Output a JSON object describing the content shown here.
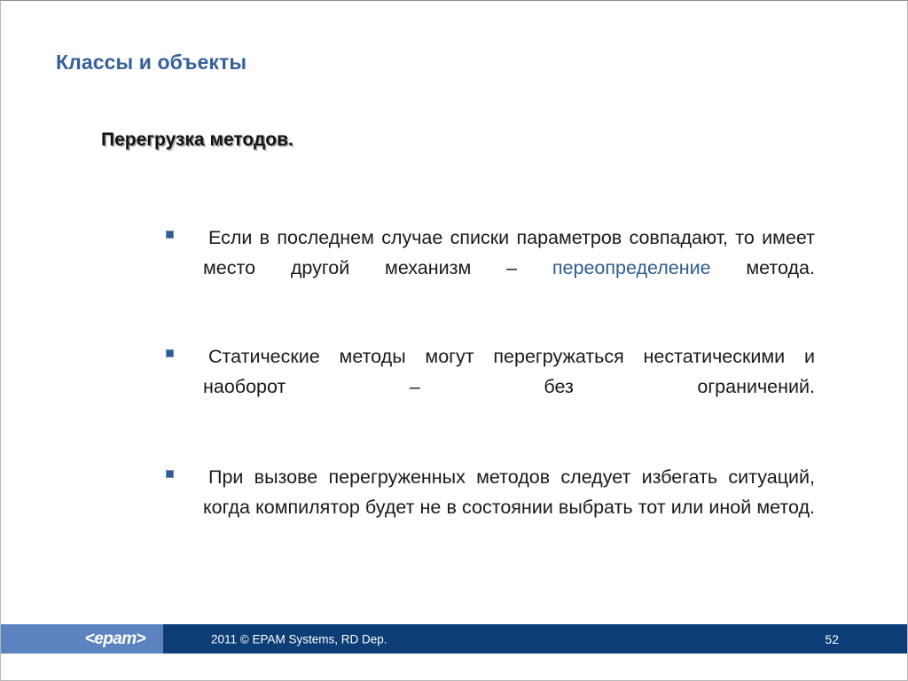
{
  "slide": {
    "title": "Классы и объекты",
    "sub_heading": "Перегрузка методов.",
    "accent_title_color": "#36609B",
    "accent_link_color": "#2F5D8C",
    "bullet_marker_color": "#2E5B92",
    "footer_logo_block_color": "#5A83C0",
    "footer_bar_color": "#0D3D77",
    "background_color": "#FFFFFF"
  },
  "bullets": [
    {
      "marker": "square-bullet-icon",
      "text_before": "Если в последнем случае списки параметров совпадают, то имеет место другой механизм – ",
      "highlight": "переопределение",
      "text_after": " метода."
    },
    {
      "marker": "square-bullet-icon",
      "text_before": "Статические методы могут перегружаться нестатическими и наоборот – без ограничений.",
      "highlight": "",
      "text_after": ""
    },
    {
      "marker": "square-bullet-icon",
      "text_before": "При вызове перегруженных методов следует избегать ситуаций, когда компилятор будет не в состоянии выбрать тот или иной метод.",
      "highlight": "",
      "text_after": ""
    }
  ],
  "footer": {
    "logo": "<epam>",
    "copyright": "2011 © EPAM Systems, RD Dep.",
    "page_number": "52"
  }
}
